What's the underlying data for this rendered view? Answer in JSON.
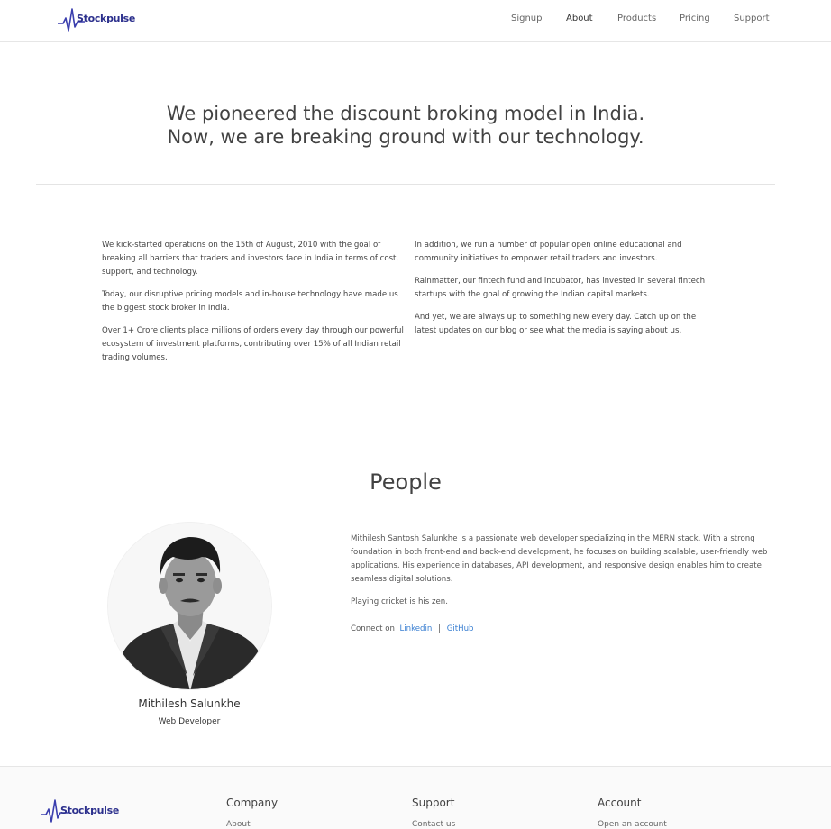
{
  "brand": {
    "name": "Stockpulse",
    "color": "#2b2f8c",
    "accent": "#387ed1"
  },
  "nav": {
    "items": [
      {
        "label": "Signup"
      },
      {
        "label": "About"
      },
      {
        "label": "Products"
      },
      {
        "label": "Pricing"
      },
      {
        "label": "Support"
      }
    ]
  },
  "hero": {
    "line1": "We pioneered the discount broking model in India.",
    "line2": "Now, we are breaking ground with our technology."
  },
  "about": {
    "left": [
      "We kick-started operations on the 15th of August, 2010 with the goal of breaking all barriers that traders and investors face in India in terms of cost, support, and technology.",
      "Today, our disruptive pricing models and in-house technology have made us the biggest stock broker in India.",
      "Over 1+ Crore clients place millions of orders every day through our powerful ecosystem of investment platforms, contributing over 15% of all Indian retail trading volumes."
    ],
    "right": [
      "In addition, we run a number of popular open online educational and community initiatives to empower retail traders and investors.",
      "Rainmatter, our fintech fund and incubator, has invested in several fintech startups with the goal of growing the Indian capital markets.",
      "And yet, we are always up to something new every day. Catch up on the latest updates on our blog or see what the media is saying about us."
    ]
  },
  "people": {
    "title": "People",
    "person": {
      "name": "Mithilesh Salunkhe",
      "role": "Web Developer",
      "bio": "Mithilesh Santosh Salunkhe is a passionate web developer specializing in the MERN stack. With a strong foundation in both front-end and back-end development, he focuses on building scalable, user-friendly web applications. His experience in databases, API development, and responsive design enables him to create seamless digital solutions.",
      "hobby": "Playing cricket is his zen.",
      "connect_label": "Connect on",
      "links": [
        {
          "label": "Linkedin"
        },
        {
          "label": "GitHub"
        }
      ],
      "separator": "|"
    }
  },
  "footer": {
    "columns": [
      {
        "heading": "Company",
        "first_link": "About"
      },
      {
        "heading": "Support",
        "first_link": "Contact us"
      },
      {
        "heading": "Account",
        "first_link": "Open an account"
      }
    ]
  }
}
